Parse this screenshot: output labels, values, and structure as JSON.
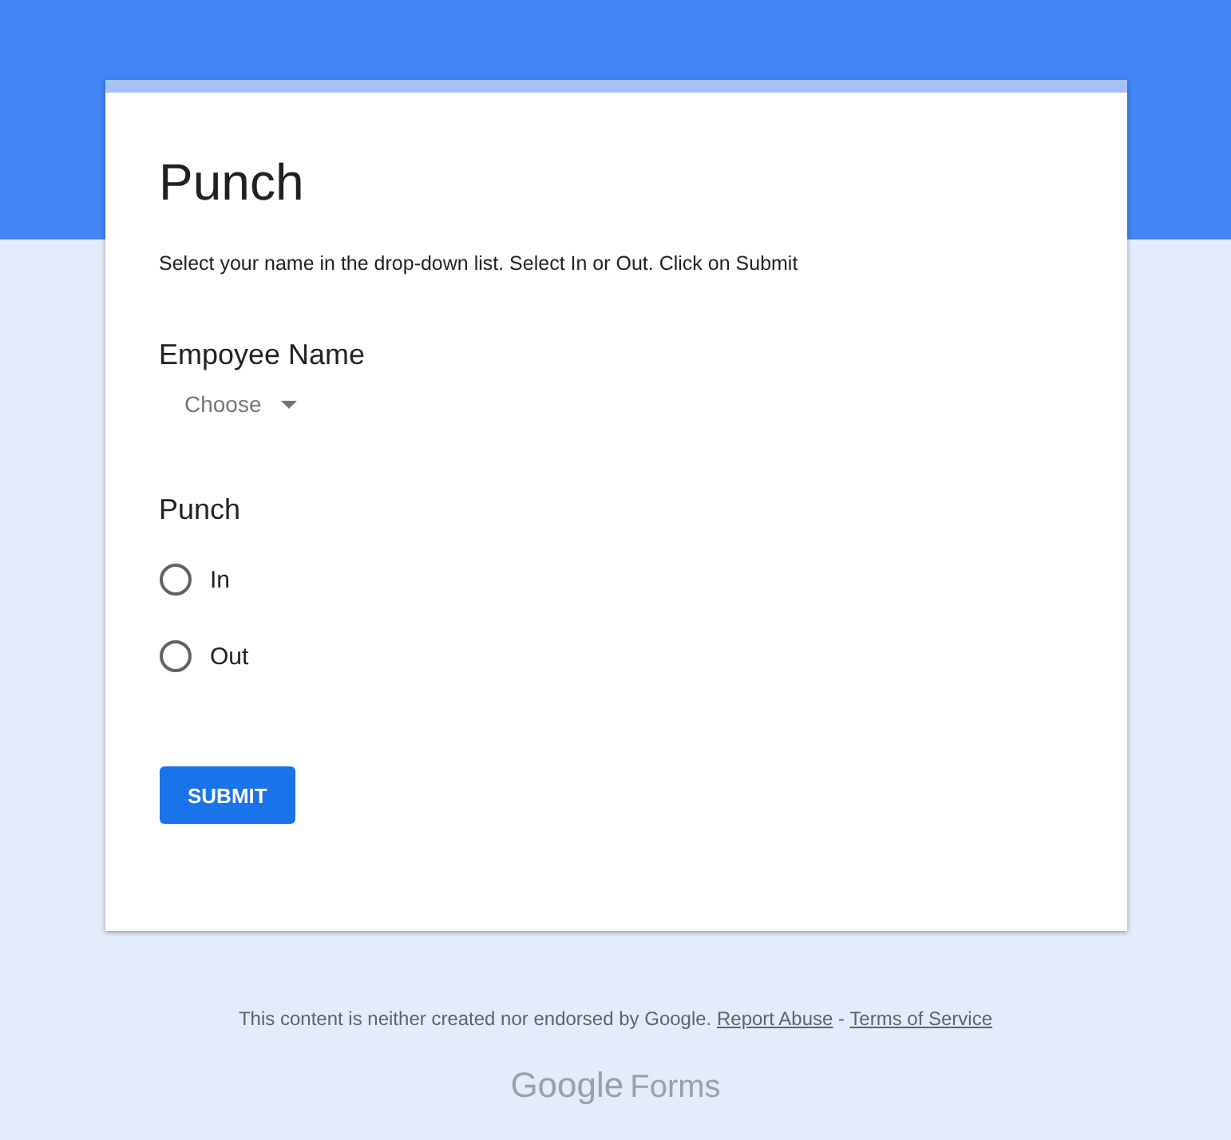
{
  "form": {
    "title": "Punch",
    "description": "Select your name in the drop-down list. Select In or Out. Click on Submit",
    "questions": [
      {
        "kind": "dropdown",
        "label": "Empoyee Name",
        "placeholder": "Choose"
      },
      {
        "kind": "radio",
        "label": "Punch",
        "options": [
          {
            "label": "In",
            "selected": false
          },
          {
            "label": "Out",
            "selected": false
          }
        ]
      }
    ],
    "submit": "SUBMIT"
  },
  "footer": {
    "notice": "This content is neither created nor endorsed by Google.",
    "links": [
      "Report Abuse",
      "Terms of Service"
    ],
    "separator": "-"
  },
  "logo": {
    "brand": "Google",
    "product": "Forms"
  }
}
